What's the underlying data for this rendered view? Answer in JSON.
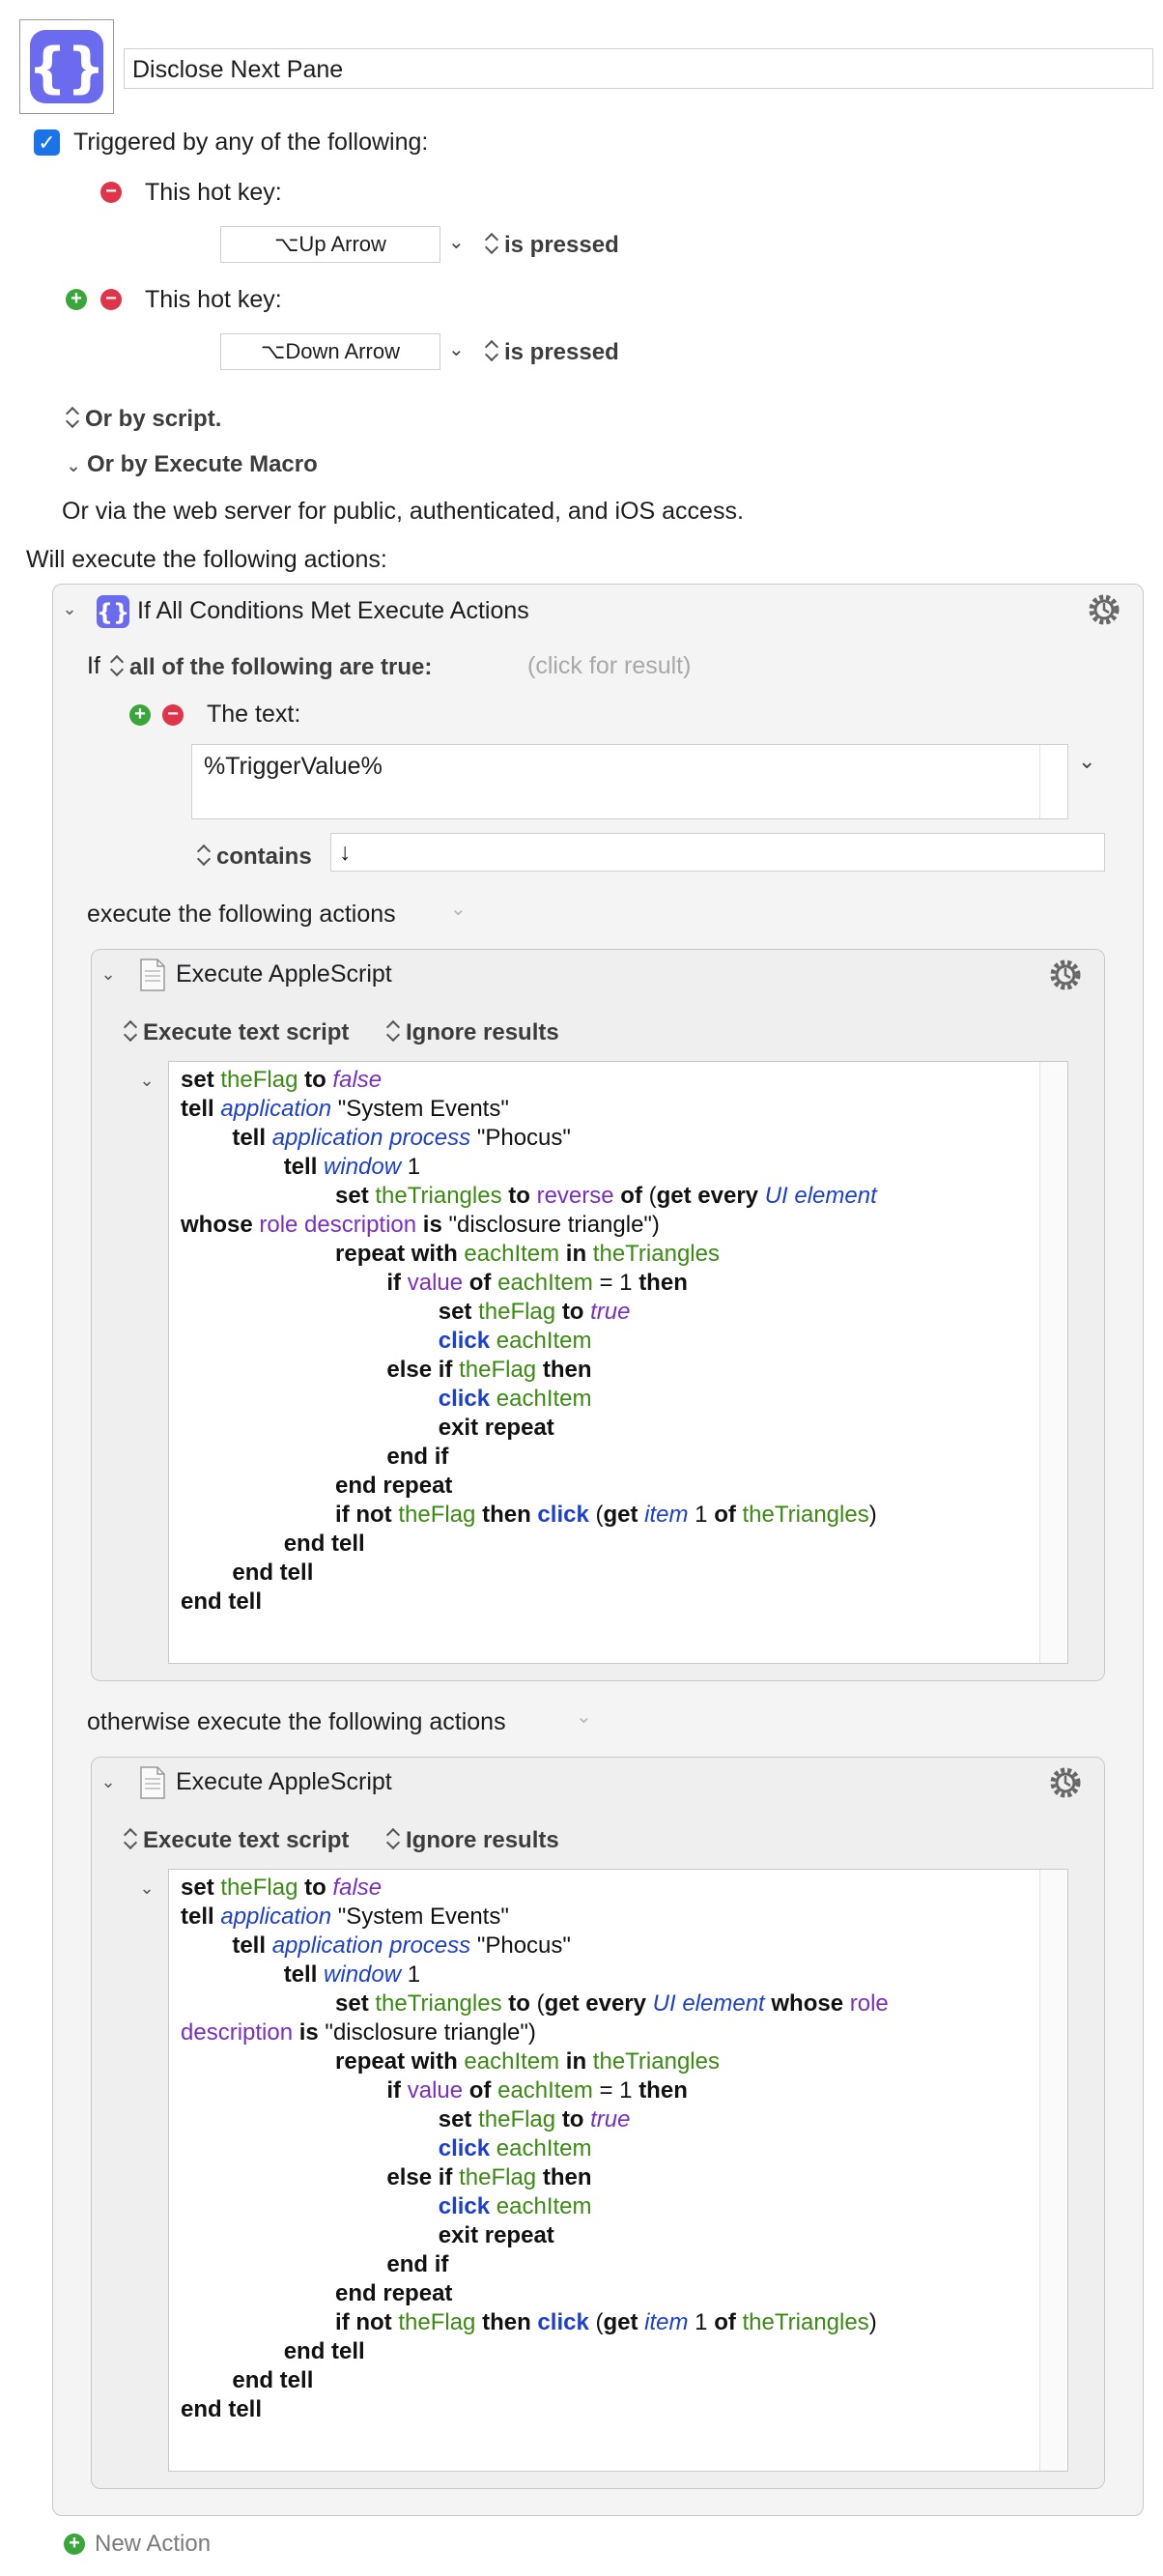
{
  "macro": {
    "name": "Disclose Next Pane"
  },
  "triggers": {
    "checkbox_label": "Triggered by any of the following:",
    "hotkey_label": "This hot key:",
    "hotkey1": {
      "key": "⌥Up Arrow",
      "condition": "is pressed"
    },
    "hotkey2": {
      "key": "⌥Down Arrow",
      "condition": "is pressed"
    },
    "or_by_script": "Or by script.",
    "or_by_execute_macro": "Or by Execute Macro",
    "web_server_note": "Or via the web server for public, authenticated, and iOS access."
  },
  "actions_header": "Will execute the following actions:",
  "if_action": {
    "title": "If All Conditions Met Execute Actions",
    "if_word": "If",
    "condition_mode": "all of the following are true:",
    "click_for_result": "(click for result)",
    "text_label": "The text:",
    "text_value": "%TriggerValue%",
    "contains_label": "contains",
    "contains_value": "↓",
    "then_label": "execute the following actions",
    "else_label": "otherwise execute the following actions"
  },
  "applescript1": {
    "title": "Execute AppleScript",
    "mode": "Execute text script",
    "results": "Ignore results"
  },
  "applescript2": {
    "title": "Execute AppleScript",
    "mode": "Execute text script",
    "results": "Ignore results"
  },
  "new_action": "New Action",
  "colors": {
    "keyword": "#111111",
    "variable": "#3b8a12",
    "property": "#7a2fc4",
    "class": "#1c3fd0",
    "accent_checkbox": "#1a73e8",
    "minus": "#e0344a",
    "plus": "#3aa63a"
  }
}
